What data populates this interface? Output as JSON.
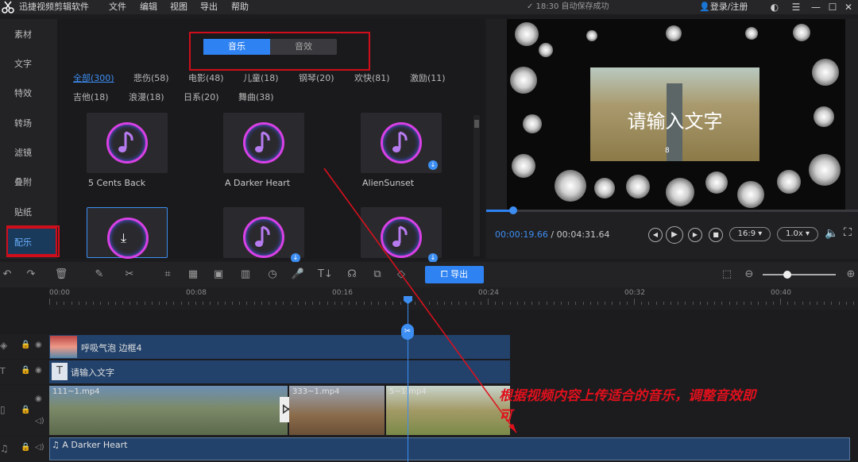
{
  "app": {
    "title": "迅捷视频剪辑软件",
    "save_status": "✓ 18:30 自动保存成功",
    "login": "登录/注册"
  },
  "menu": [
    "文件",
    "编辑",
    "视图",
    "导出",
    "帮助"
  ],
  "sidebar": {
    "items": [
      "素材",
      "文字",
      "特效",
      "转场",
      "滤镜",
      "叠附",
      "贴纸",
      "配乐"
    ],
    "active_index": 7
  },
  "library": {
    "tabs": [
      "音乐",
      "音效"
    ],
    "categories": [
      "全部(300)",
      "悲伤(58)",
      "电影(48)",
      "儿童(18)",
      "钢琴(20)",
      "欢快(81)",
      "激励(11)",
      "吉他(18)",
      "浪漫(18)",
      "日系(20)",
      "舞曲(38)"
    ],
    "cards": [
      {
        "label": "5 Cents Back"
      },
      {
        "label": "A Darker Heart"
      },
      {
        "label": "AlienSunset"
      },
      {
        "label": ""
      },
      {
        "label": ""
      },
      {
        "label": ""
      }
    ]
  },
  "preview": {
    "overlay_text": "请输入文字",
    "frame_number": "8",
    "current_time": "00:00:19.66",
    "separator": "/",
    "total_time": "00:04:31.64",
    "aspect": "16:9",
    "speed": "1.0x",
    "progress": 0.072
  },
  "toolbar": {
    "export_label": "导出"
  },
  "ruler": {
    "labels": [
      "00:00",
      "00:08",
      "00:16",
      "00:24",
      "00:32",
      "00:40"
    ]
  },
  "tracks": {
    "effect_clip": "呼吸气泡 边框4",
    "text_clip": "请输入文字",
    "video_clips": [
      "111~1.mp4",
      "333~1.mp4",
      "5~1.mp4"
    ],
    "audio_clip": "A Darker Heart"
  },
  "annotation": {
    "line1": "根据视频内容上传适合的音乐，调整音效即",
    "line2": "可"
  },
  "colors": {
    "accent": "#2e82f2",
    "annotation": "#e0101c",
    "track_clip": "#22426b"
  }
}
